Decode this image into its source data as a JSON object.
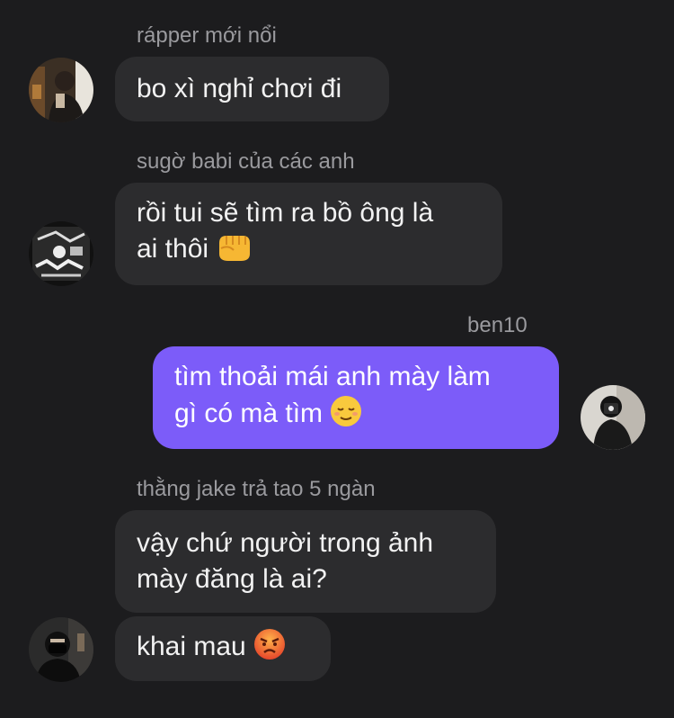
{
  "messages": [
    {
      "sender": "rápper mới nổi",
      "direction": "incoming",
      "avatar": "photo-avatar-person-indoors",
      "lines": [
        "bo xì nghỉ chơi đi"
      ]
    },
    {
      "sender": "sugờ babi của các anh",
      "direction": "incoming",
      "avatar": "photo-avatar-graffiti-wall",
      "lines": [
        "rồi tui sẽ tìm ra bồ ông là",
        "ai thôi"
      ],
      "emoji": "fist-emoji"
    },
    {
      "sender": "ben10",
      "direction": "outgoing",
      "avatar": "photo-avatar-mirror-selfie",
      "lines": [
        "tìm thoải mái anh mày làm",
        "gì có mà tìm"
      ],
      "emoji": "relieved-face-emoji"
    },
    {
      "sender": "thằng jake trả tao 5 ngàn",
      "direction": "incoming",
      "avatar": "photo-avatar-masked-person",
      "lines": [
        "vậy chứ người trong ảnh",
        "mày đăng là ai?"
      ]
    },
    {
      "sender": "",
      "direction": "incoming",
      "lines": [
        "khai mau"
      ],
      "emoji": "angry-face-emoji"
    }
  ],
  "colors": {
    "background": "#1c1c1e",
    "incoming_bubble": "#2c2c2e",
    "outgoing_bubble": "#7c5cf9",
    "sender_name": "#9a9a9e"
  }
}
